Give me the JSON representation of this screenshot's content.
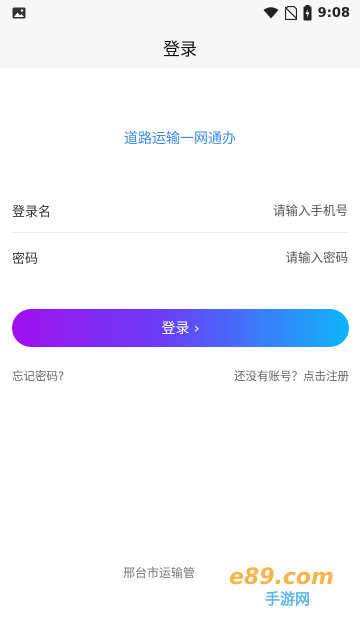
{
  "status_bar": {
    "time": "9:08",
    "icons": [
      "image-icon",
      "wifi-icon",
      "no-sim-icon",
      "battery-icon"
    ]
  },
  "header": {
    "title": "登录"
  },
  "app": {
    "tagline": "道路运输一网通办"
  },
  "form": {
    "username_label": "登录名",
    "username_placeholder": "请输入手机号",
    "password_label": "密码",
    "password_placeholder": "请输入密码"
  },
  "login_button": {
    "label": "登录 ›"
  },
  "links": {
    "forgot_password": "忘记密码?",
    "register": "还没有账号？点击注册"
  },
  "footer": {
    "text": "邢台市运输管"
  },
  "watermark": {
    "text": "e89.com",
    "subtext": "手游网"
  },
  "colors": {
    "accent": "#3b8be8",
    "button_gradient_start": "#a010f0",
    "button_gradient_end": "#0fb5fb"
  }
}
